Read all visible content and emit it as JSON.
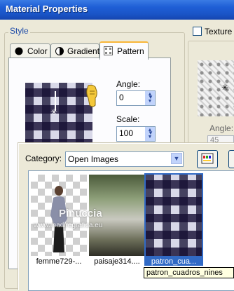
{
  "window": {
    "title": "Material Properties"
  },
  "style_group": {
    "label": "Style"
  },
  "tabs": [
    {
      "label": "Color",
      "active": false
    },
    {
      "label": "Gradient",
      "active": false
    },
    {
      "label": "Pattern",
      "active": true
    }
  ],
  "pattern": {
    "angle_label": "Angle:",
    "angle_value": "0",
    "scale_label": "Scale:",
    "scale_value": "100"
  },
  "texture": {
    "checkbox_label": "Texture",
    "checked": false,
    "angle_label": "Angle:",
    "angle_value": "45"
  },
  "browser": {
    "category_label": "Category:",
    "category_value": "Open Images",
    "images": [
      {
        "caption": "femme729-...",
        "selected": false
      },
      {
        "caption": "paisaje314....",
        "selected": false
      },
      {
        "caption": "patron_cua...",
        "selected": true
      }
    ],
    "tooltip": "patron_cuadros_nines"
  },
  "watermark": {
    "line1": "Pinuccia",
    "line2": "www.madiregrafica.eu"
  },
  "colors": {
    "titlebar": "#1f5fd6",
    "accent_tab": "#f9b638",
    "selection": "#316ac5",
    "tooltip_bg": "#ffffe1"
  }
}
